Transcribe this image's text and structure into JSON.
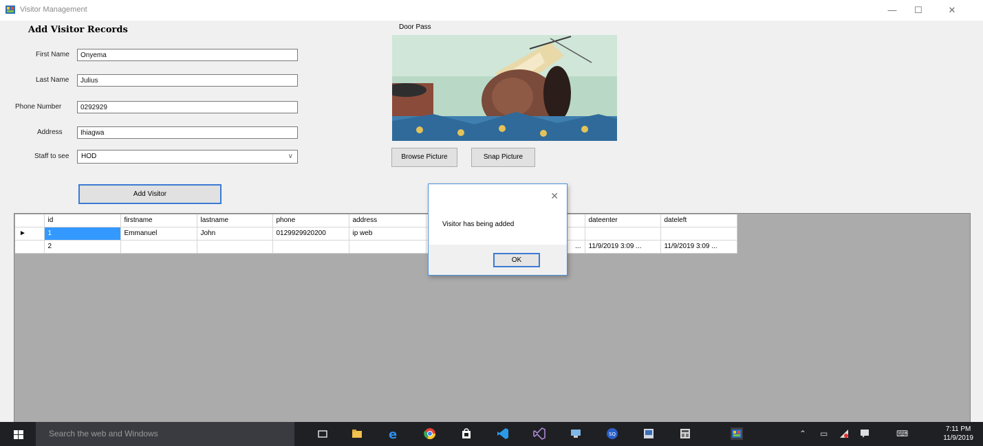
{
  "window": {
    "title": "Visitor Management",
    "controls": {
      "minimize": "—",
      "maximize": "☐",
      "close": "✕"
    }
  },
  "form": {
    "title": "Add Visitor Records",
    "fields": {
      "first_name": {
        "label": "First Name",
        "value": "Onyema"
      },
      "last_name": {
        "label": "Last Name",
        "value": "Julius"
      },
      "phone": {
        "label": "Phone Number",
        "value": "0292929"
      },
      "address": {
        "label": "Address",
        "value": "Ihiagwa"
      },
      "staff": {
        "label": "Staff to see",
        "value": "HOD"
      }
    },
    "add_button": "Add Visitor"
  },
  "door_pass": {
    "label": "Door Pass",
    "browse_button": "Browse Picture",
    "snap_button": "Snap Picture"
  },
  "grid": {
    "columns": [
      "id",
      "firstname",
      "lastname",
      "phone",
      "address",
      "",
      "dateenter",
      "dateleft"
    ],
    "rows": [
      {
        "marker": "►",
        "cells": [
          "1",
          "Emmanuel",
          "John",
          "0129929920200",
          "ip web",
          "",
          "",
          ""
        ]
      },
      {
        "marker": "",
        "cells": [
          "2",
          "",
          "",
          "",
          "",
          "...",
          "11/9/2019 3:09 ...",
          "11/9/2019 3:09 ..."
        ]
      }
    ]
  },
  "dialog": {
    "message": "Visitor has being added",
    "ok_label": "OK",
    "close": "✕"
  },
  "taskbar": {
    "search_placeholder": "Search the web and Windows",
    "time": "7:11 PM",
    "date": "11/9/2019"
  },
  "colors": {
    "selection": "#3399ff",
    "taskbar": "#1f2024",
    "dialog_border": "#4a90d9"
  }
}
